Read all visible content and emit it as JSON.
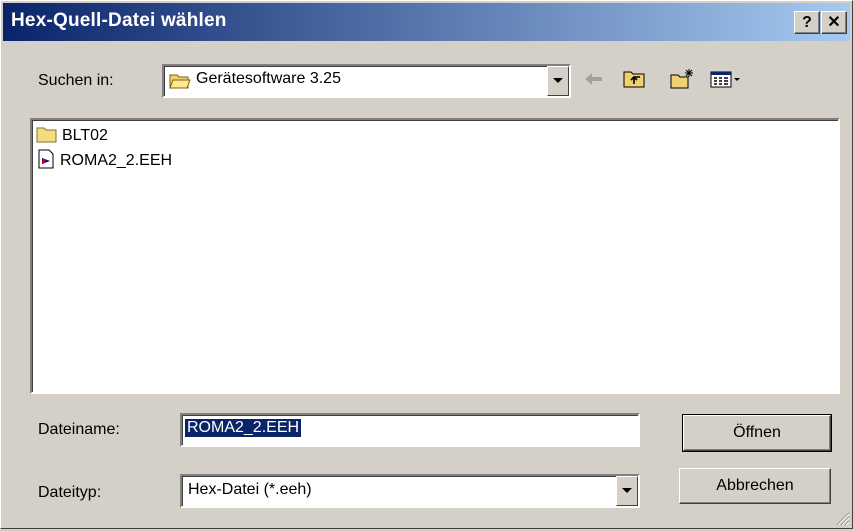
{
  "window": {
    "title": "Hex-Quell-Datei wählen",
    "help_button": "?",
    "close_button": "✕"
  },
  "look_in": {
    "label": "Suchen in:",
    "value": "Gerätesoftware 3.25"
  },
  "toolbar": {
    "icons": [
      "back-arrow-icon",
      "up-folder-icon",
      "new-folder-icon",
      "view-menu-icon"
    ]
  },
  "files": [
    {
      "name": "BLT02",
      "icon": "folder-icon"
    },
    {
      "name": "ROMA2_2.EEH",
      "icon": "file-icon"
    }
  ],
  "filename": {
    "label": "Dateiname:",
    "value": "ROMA2_2.EEH"
  },
  "filetype": {
    "label": "Dateityp:",
    "value": "Hex-Datei (*.eeh)"
  },
  "buttons": {
    "open": "Öffnen",
    "cancel": "Abbrechen"
  },
  "colors": {
    "title_start": "#0a246a",
    "title_end": "#a6caf0",
    "selection": "#0a246a",
    "face": "#d4d0c8"
  }
}
